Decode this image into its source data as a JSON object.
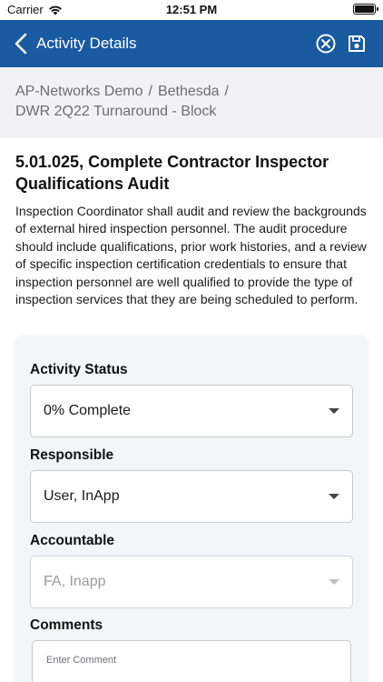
{
  "status_bar": {
    "carrier": "Carrier",
    "time": "12:51 PM",
    "wifi_icon": "wifi-icon",
    "battery_icon": "battery-icon"
  },
  "nav": {
    "title": "Activity Details",
    "back_icon": "chevron-left-icon",
    "close_icon": "close-circle-icon",
    "save_icon": "save-icon",
    "bar_color": "#1a5aa0"
  },
  "breadcrumb": {
    "items": [
      "AP-Networks Demo",
      "Bethesda",
      "DWR 2Q22 Turnaround - Block"
    ],
    "separator": "/"
  },
  "activity": {
    "title": "5.01.025, Complete Contractor Inspector Qualifications Audit",
    "description": "Inspection Coordinator shall audit and review the backgrounds of external hired inspection personnel. The audit procedure should include qualifications, prior work histories, and a review of specific inspection certification credentials to ensure that inspection personnel are well qualified to provide the type of inspection services that they are being scheduled to perform."
  },
  "form": {
    "status": {
      "label": "Activity Status",
      "value": "0% Complete"
    },
    "responsible": {
      "label": "Responsible",
      "value": "User, InApp"
    },
    "accountable": {
      "label": "Accountable",
      "value": "FA, Inapp"
    },
    "comments": {
      "label": "Comments",
      "placeholder": "Enter Comment"
    }
  }
}
